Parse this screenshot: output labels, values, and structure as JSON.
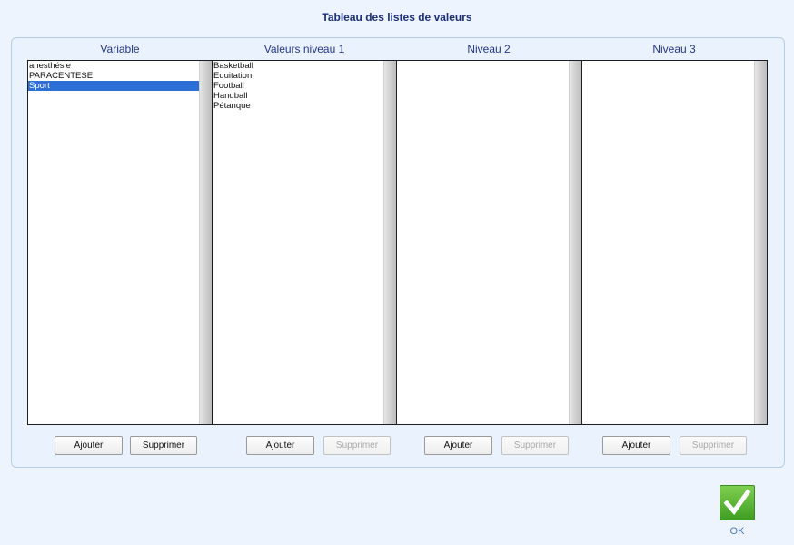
{
  "dialog": {
    "title": "Tableau des listes de valeurs"
  },
  "columns": [
    {
      "header": "Variable",
      "items": [
        "anesthésie",
        "PARACENTESE",
        "Sport"
      ],
      "selected_index": 2,
      "add_label": "Ajouter",
      "delete_label": "Supprimer",
      "delete_enabled": true
    },
    {
      "header": "Valeurs niveau 1",
      "items": [
        "Basketball",
        "Equitation",
        "Football",
        "Handball",
        "Pétanque"
      ],
      "add_label": "Ajouter",
      "delete_label": "Supprimer",
      "delete_enabled": false
    },
    {
      "header": "Niveau 2",
      "items": [],
      "add_label": "Ajouter",
      "delete_label": "Supprimer",
      "delete_enabled": false
    },
    {
      "header": "Niveau 3",
      "items": [],
      "add_label": "Ajouter",
      "delete_label": "Supprimer",
      "delete_enabled": false
    }
  ],
  "ok": {
    "label": "OK",
    "icon": "checkmark-icon"
  },
  "colors": {
    "selection": "#2c6fd6",
    "ok_green": "#4cae2c",
    "title": "#1a2f7a"
  }
}
